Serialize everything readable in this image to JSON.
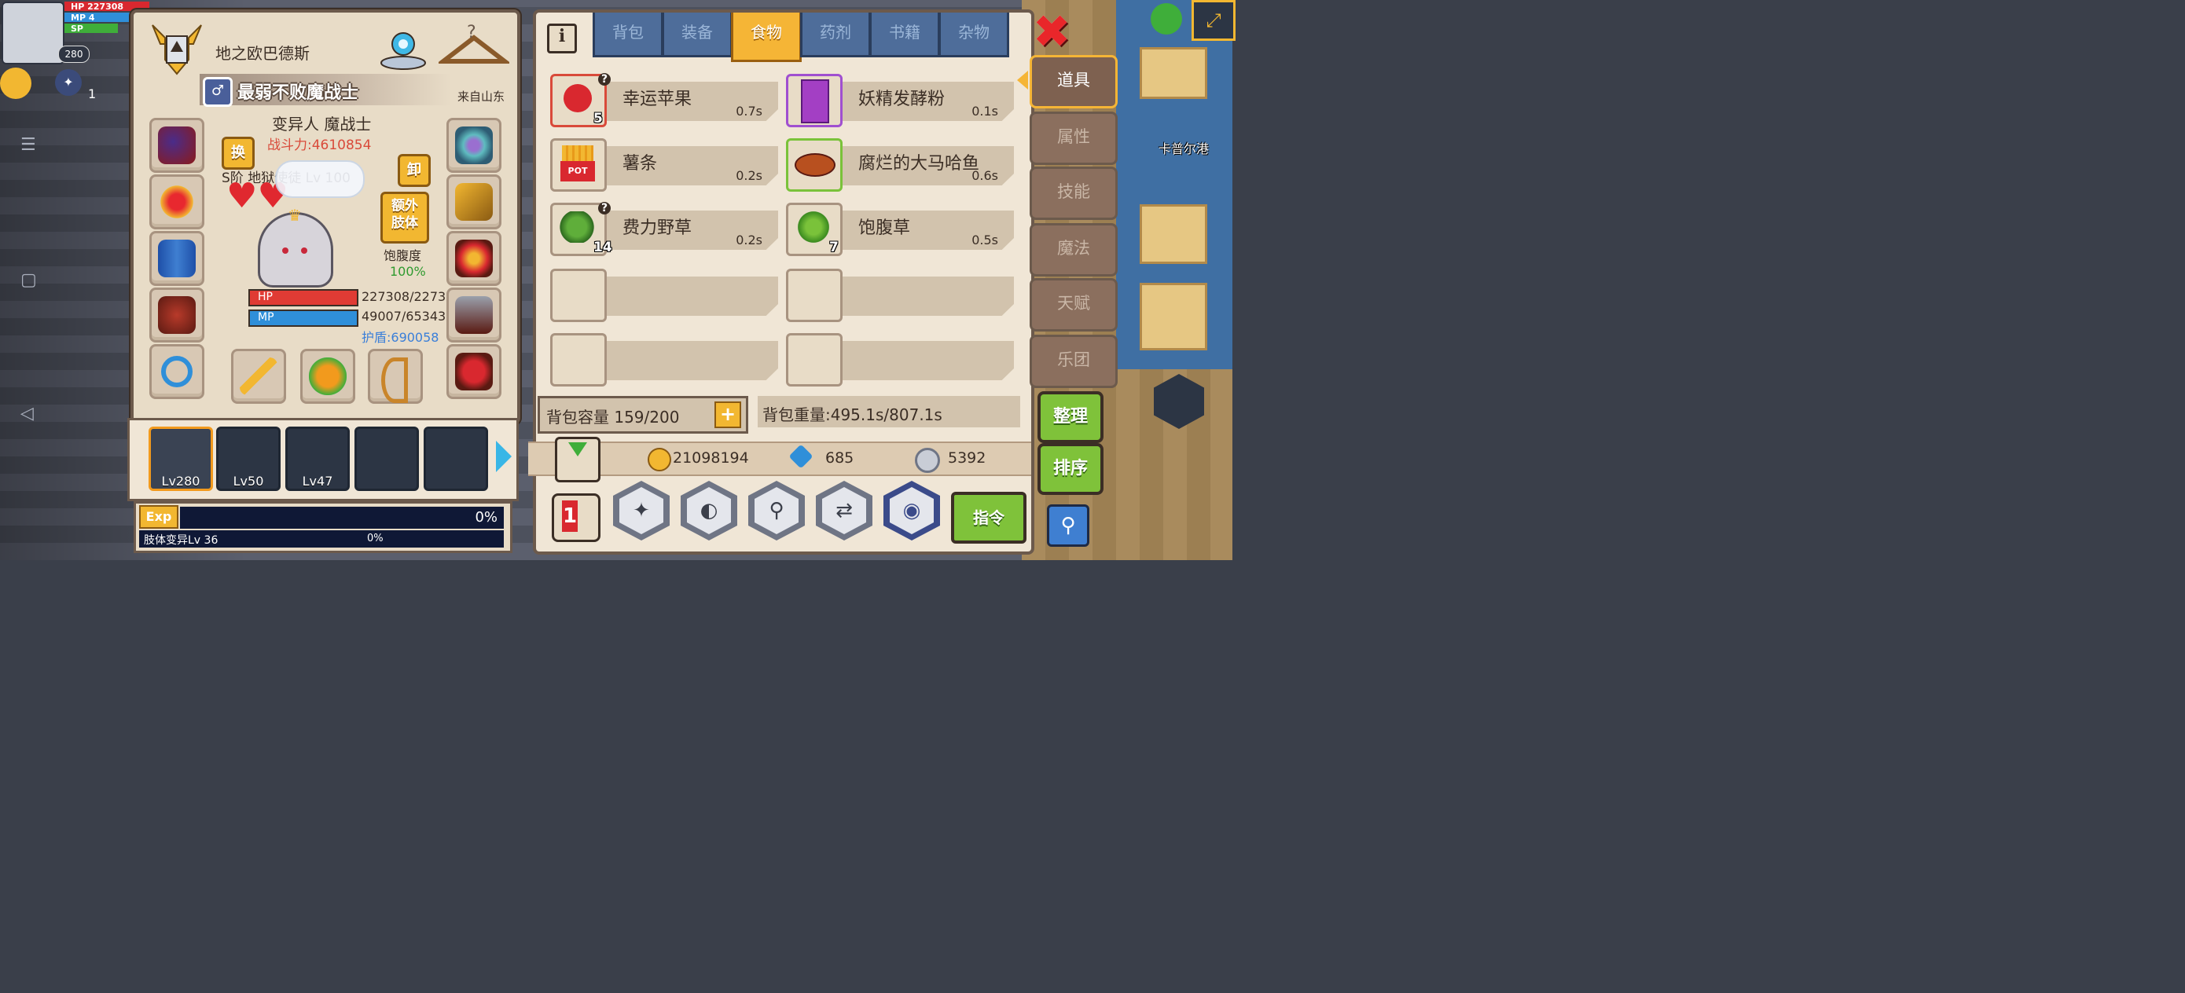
{
  "hud": {
    "hp_label": "HP",
    "hp_value": "227308",
    "mp_label": "MP",
    "mp_value": "4",
    "sp_label": "SP",
    "level": "280",
    "counter": "1"
  },
  "character": {
    "name": "地之欧巴德斯",
    "title": "最弱不败魔战士",
    "origin": "来自山东",
    "class": "变异人 魔战士",
    "power": "战斗力:4610854",
    "rank_title": "S阶 地狱使徒 Lv 100",
    "swap_btn": "换",
    "unequip_btn": "卸",
    "extra_limb_btn": "额外\n肢体",
    "satiety_label": "饱腹度",
    "satiety_value": "100%",
    "hp_label": "HP",
    "mp_label": "MP",
    "hp_value": "227308/2273",
    "mp_value": "49007/65343",
    "shield": "护盾:690058"
  },
  "party": [
    {
      "label": "Lv280",
      "active": true
    },
    {
      "label": "Lv50",
      "active": false
    },
    {
      "label": "Lv47",
      "active": false
    },
    {
      "label": "",
      "active": false
    },
    {
      "label": "",
      "active": false
    }
  ],
  "exp": {
    "label": "Exp",
    "percent": "0%",
    "limb_label": "肢体变异Lv 36",
    "limb_percent": "0%"
  },
  "inventory": {
    "info_icon": "i",
    "tabs": [
      "背包",
      "装备",
      "食物",
      "药剂",
      "书籍",
      "杂物"
    ],
    "active_tab": 2,
    "items": [
      {
        "name": "幸运苹果",
        "weight": "0.7s",
        "qty": "5",
        "unknown": true,
        "rarity": "red"
      },
      {
        "name": "妖精发酵粉",
        "weight": "0.1s",
        "qty": "",
        "unknown": false,
        "rarity": "purple"
      },
      {
        "name": "薯条",
        "weight": "0.2s",
        "qty": "",
        "unknown": false,
        "rarity": "plain"
      },
      {
        "name": "腐烂的大马哈鱼",
        "weight": "0.6s",
        "qty": "",
        "unknown": false,
        "rarity": "green"
      },
      {
        "name": "费力野草",
        "weight": "0.2s",
        "qty": "14",
        "unknown": true,
        "rarity": "plain"
      },
      {
        "name": "饱腹草",
        "weight": "0.5s",
        "qty": "7",
        "unknown": false,
        "rarity": "plain"
      }
    ],
    "fries_tag": "POT",
    "capacity": "背包容量 159/200",
    "capacity_plus": "+",
    "weight": "背包重量:495.1s/807.1s",
    "gold": "21098194",
    "diamond": "685",
    "silver": "5392",
    "command_btn": "指令",
    "qmark": "?"
  },
  "side_menu": [
    "道具",
    "属性",
    "技能",
    "魔法",
    "天赋",
    "乐团"
  ],
  "side_active": 0,
  "actions": {
    "organize": "整理",
    "sort": "排序"
  },
  "map": {
    "location": "卡普尔港"
  },
  "colors": {
    "panel": "#f0e6d6",
    "border": "#6c5a4c",
    "tab_blue": "#4e6d9a",
    "tab_active": "#f5b536",
    "green_button": "#7fc23a",
    "power_red": "#d94a3a",
    "shield_blue": "#3a7fd9"
  }
}
